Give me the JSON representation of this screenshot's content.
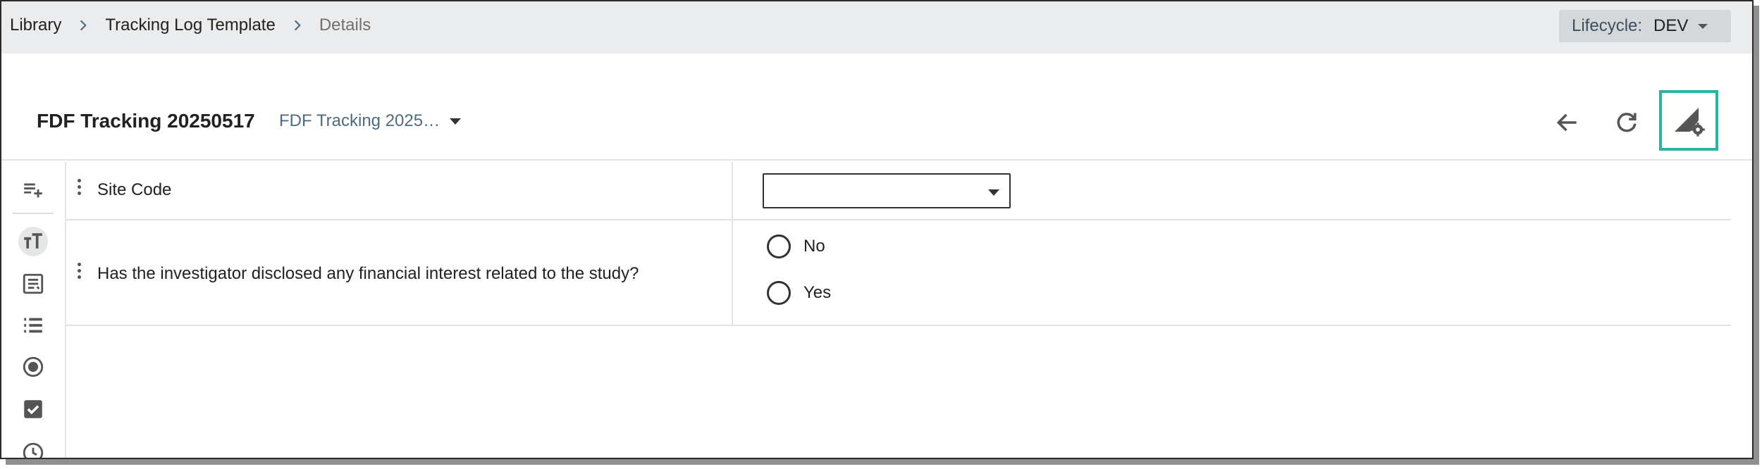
{
  "breadcrumb": {
    "items": [
      "Library",
      "Tracking Log Template",
      "Details"
    ]
  },
  "lifecycle": {
    "label": "Lifecycle:",
    "value": "DEV"
  },
  "header": {
    "form_title": "FDF Tracking 20250517",
    "version_selected": "FDF Tracking 2025…",
    "back_icon": "arrow-left-icon",
    "refresh_icon": "refresh-icon",
    "settings_icon": "form-settings-icon"
  },
  "sidebar": {
    "tools": [
      {
        "icon": "add-list-icon"
      },
      {
        "icon": "text-size-icon",
        "active": true
      },
      {
        "icon": "text-area-icon"
      },
      {
        "icon": "list-icon"
      },
      {
        "icon": "radio-icon"
      },
      {
        "icon": "checkbox-icon"
      },
      {
        "icon": "clock-icon"
      }
    ]
  },
  "form": {
    "rows": [
      {
        "label": "Site Code",
        "type": "dropdown",
        "value": ""
      },
      {
        "label": "Has the investigator disclosed any financial interest related to the study?",
        "type": "radio",
        "options": [
          "No",
          "Yes"
        ]
      }
    ]
  },
  "colors": {
    "accent": "#2bb3a1",
    "topbar_bg": "#ebeced",
    "lifecycle_bg": "#d4d8db",
    "version_text": "#4f6b80"
  }
}
